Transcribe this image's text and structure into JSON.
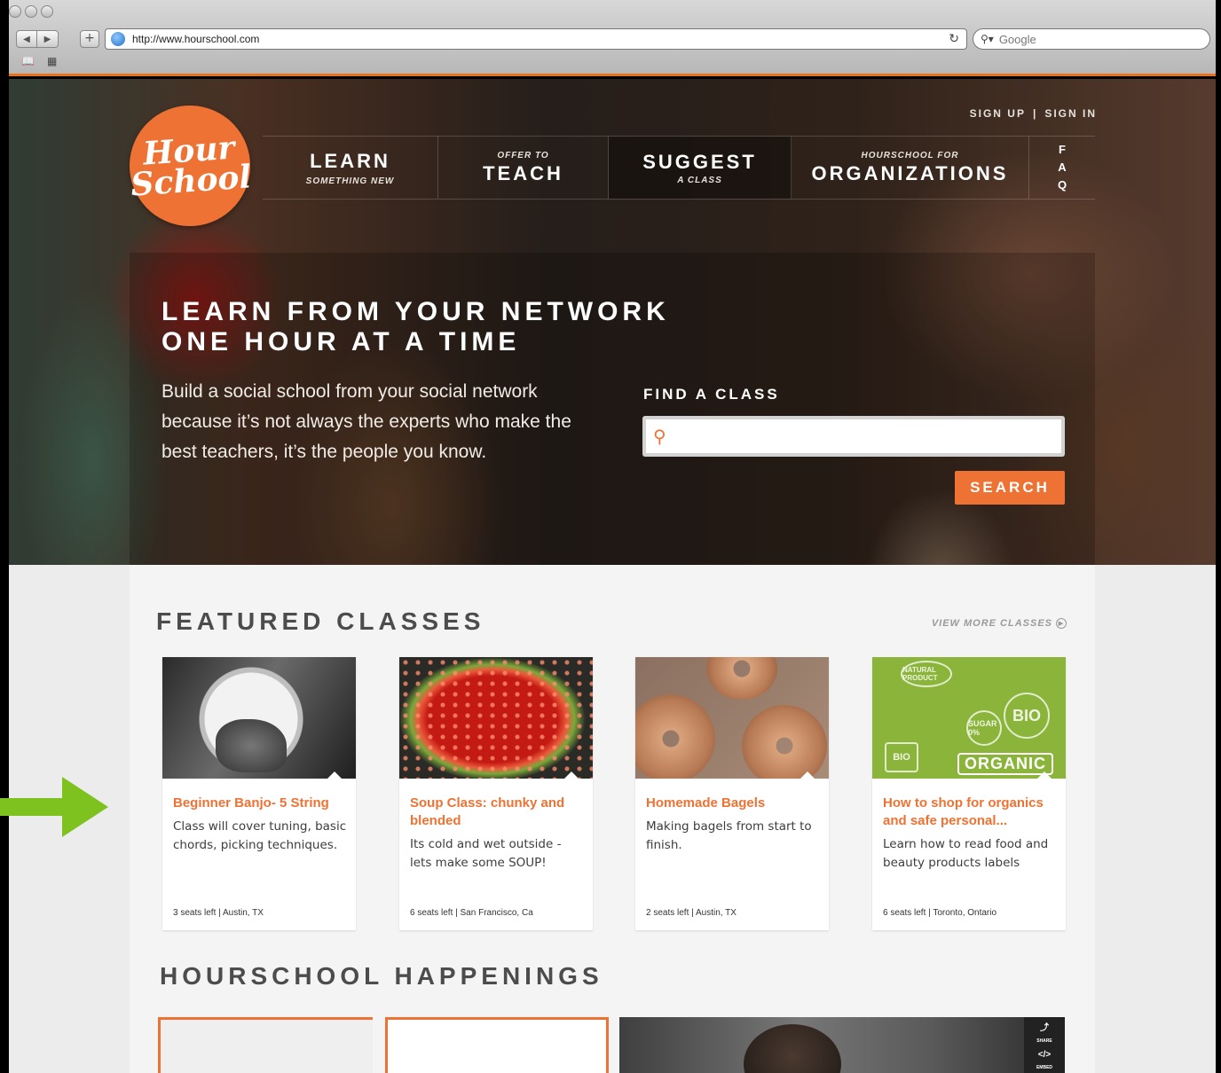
{
  "browser": {
    "url": "http://www.hourschool.com",
    "search_placeholder": "Google"
  },
  "header": {
    "logo_line1": "Hour",
    "logo_line2": "School",
    "sign_up": "SIGN UP",
    "separator": "|",
    "sign_in": "SIGN IN"
  },
  "nav": {
    "learn": {
      "big": "LEARN",
      "small": "SOMETHING NEW"
    },
    "teach": {
      "small": "OFFER TO",
      "big": "TEACH"
    },
    "suggest": {
      "big": "SUGGEST",
      "small": "A CLASS"
    },
    "orgs": {
      "small": "HOURSCHOOL FOR",
      "big": "ORGANIZATIONS"
    },
    "faq": [
      "F",
      "A",
      "Q"
    ]
  },
  "hero": {
    "headline_line1": "LEARN FROM YOUR NETWORK",
    "headline_line2": "ONE HOUR AT A TIME",
    "tagline": "Build a social school from your social network because it’s not always the experts who make the best teachers, it’s the people you know.",
    "find_label": "FIND A CLASS",
    "search_value": "",
    "search_button": "SEARCH"
  },
  "featured": {
    "title": "FEATURED CLASSES",
    "view_more": "VIEW MORE CLASSES",
    "classes": [
      {
        "title": "Beginner Banjo- 5 String",
        "desc": "Class will cover tuning, basic chords, picking techniques.",
        "meta": "3 seats left | Austin, TX"
      },
      {
        "title": "Soup Class: chunky and blended",
        "desc": "Its cold and wet outside - lets make some SOUP!",
        "meta": "6 seats left | San Francisco, Ca"
      },
      {
        "title": "Homemade Bagels",
        "desc": "Making bagels from start to finish.",
        "meta": "2 seats left | Austin, TX"
      },
      {
        "title": "How to shop for organics and safe personal...",
        "desc": "Learn how to read food and beauty products labels",
        "meta": "6 seats left | Toronto, Ontario"
      }
    ],
    "organic_labels": {
      "natural": "NATURAL PRODUCT",
      "bio1": "BIO",
      "bio2": "BIO",
      "sugar": "SUGAR 0%",
      "organic": "ORGANIC"
    }
  },
  "happenings": {
    "title": "HOURSCHOOL HAPPENINGS",
    "video_share": "SHARE",
    "video_embed": "EMBED"
  },
  "colors": {
    "brand_orange": "#ee7233",
    "arrow_green": "#7dc21e"
  }
}
